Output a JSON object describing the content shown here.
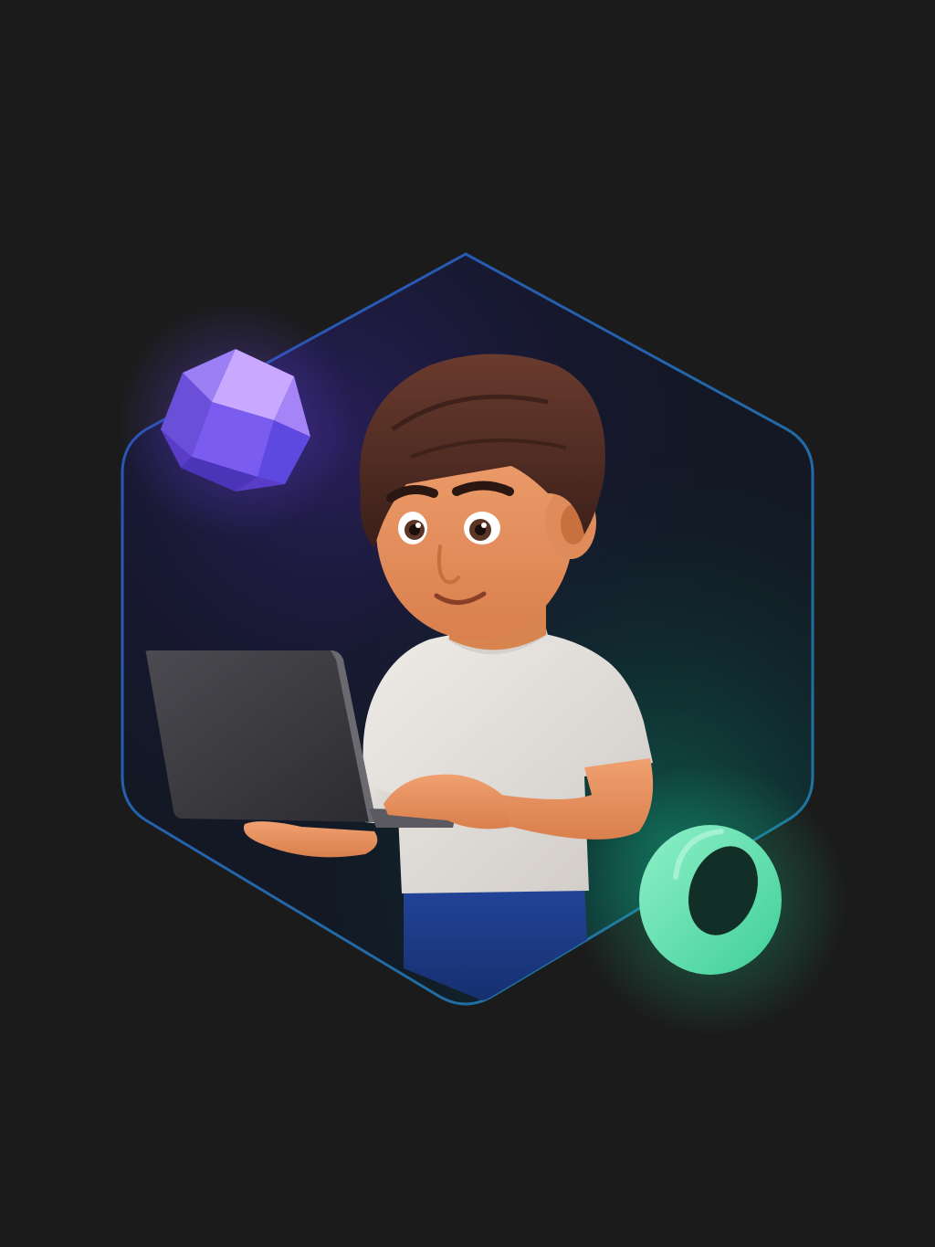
{
  "image": {
    "background_color": "#1b1b1b",
    "hex_frame_color": "#1f5fa8",
    "hex_glow_purple": "#3b2a7a",
    "hex_glow_teal": "#0f6b5a",
    "gem_color": "#7b5cf0",
    "gem_highlight": "#d8b8ff",
    "ring_color": "#5fe3b3",
    "skin_color": "#e9935f",
    "hair_color": "#4a2a22",
    "shirt_color": "#e4e0dc",
    "pants_color": "#1d3b8c",
    "laptop_color": "#3a3a3e"
  },
  "icons": [
    "hexagon-frame-icon",
    "purple-gem-icon",
    "green-ring-icon"
  ]
}
